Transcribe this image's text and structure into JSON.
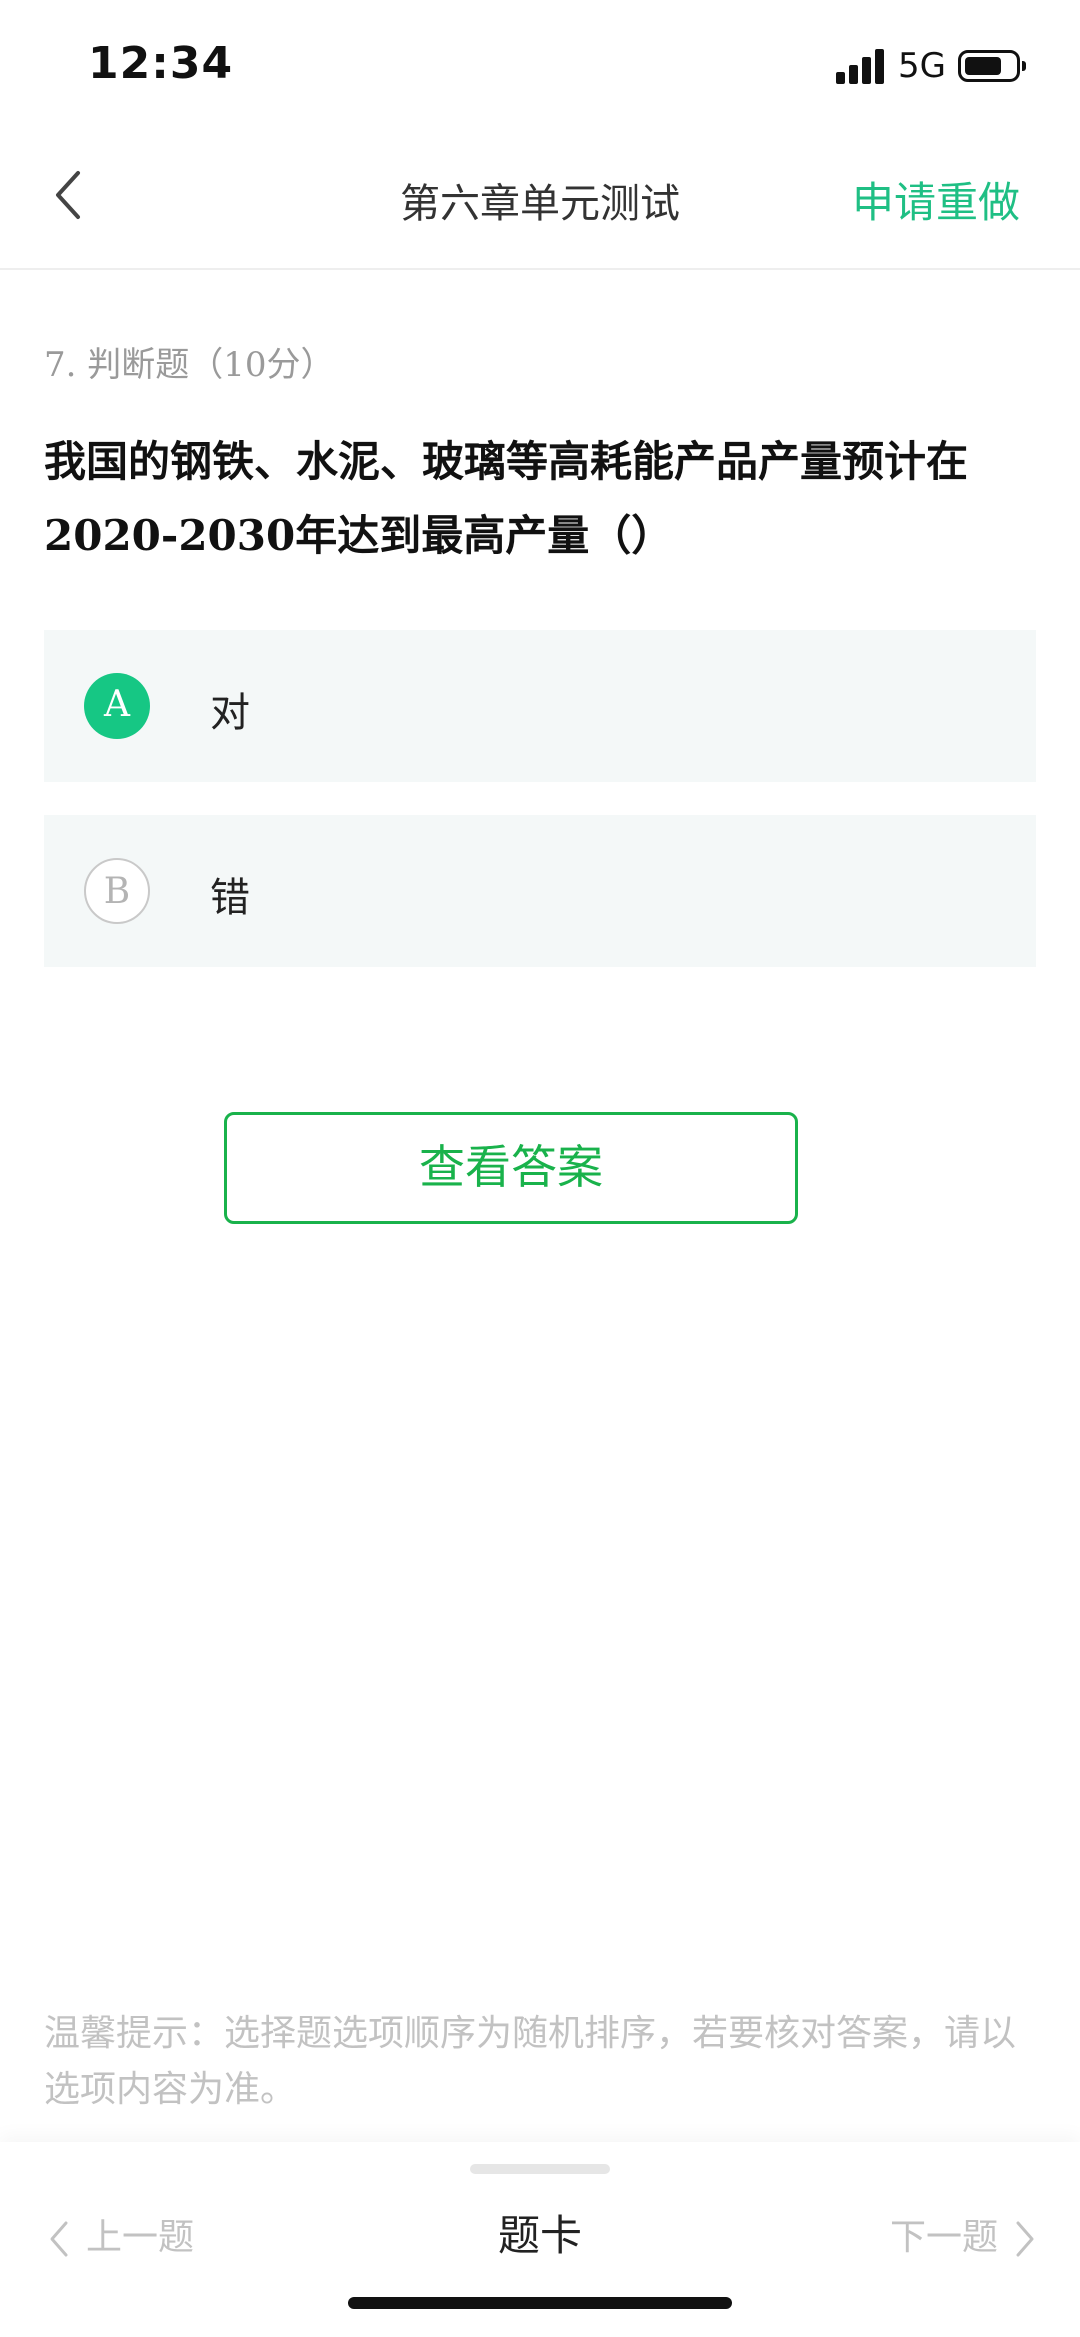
{
  "status_bar": {
    "time": "12:34",
    "network": "5G"
  },
  "nav": {
    "title": "第六章单元测试",
    "redo_label": "申请重做"
  },
  "question": {
    "meta": "7. 判断题（10分）",
    "text": "我国的钢铁、水泥、玻璃等高耗能产品产量预计在2020-2030年达到最高产量（）"
  },
  "options": [
    {
      "letter": "A",
      "label": "对",
      "selected": true
    },
    {
      "letter": "B",
      "label": "错",
      "selected": false
    }
  ],
  "answer_button_label": "查看答案",
  "tip": "温馨提示：选择题选项顺序为随机排序，若要核对答案，请以选项内容为准。",
  "bottom": {
    "prev_label": "上一题",
    "card_label": "题卡",
    "next_label": "下一题"
  },
  "colors": {
    "accent_green": "#1fbf84",
    "button_green": "#19b24b",
    "option_bg": "#f4f8f8"
  }
}
